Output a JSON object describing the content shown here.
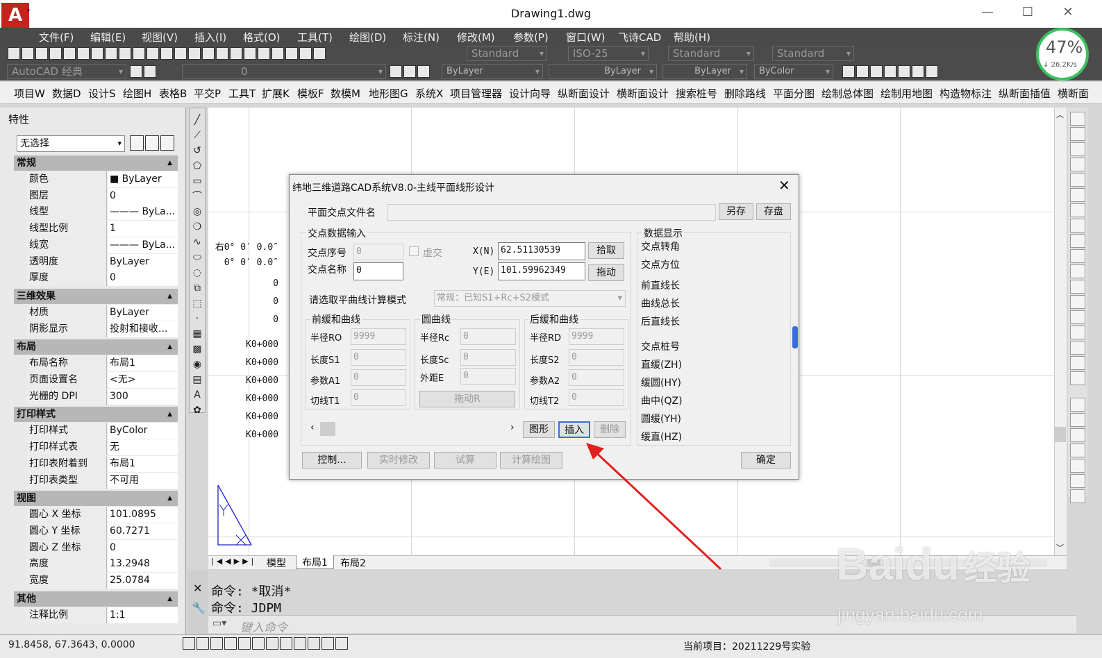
{
  "window": {
    "title": "Drawing1.dwg",
    "minimize": "—",
    "maximize": "☐",
    "close": "✕",
    "logo": "A"
  },
  "menu": [
    "文件(F)",
    "编辑(E)",
    "视图(V)",
    "插入(I)",
    "格式(O)",
    "工具(T)",
    "绘图(D)",
    "标注(N)",
    "修改(M)",
    "参数(P)",
    "窗口(W)",
    "飞诗CAD",
    "帮助(H)"
  ],
  "styles": {
    "text_style": "Standard",
    "dim_style": "ISO-25",
    "table_style": "Standard",
    "mleader_style": "Standard"
  },
  "workspace": "AutoCAD 经典",
  "layer": {
    "current": "0",
    "color": "ByLayer",
    "linetype": "ByLayer",
    "lineweight": "ByLayer",
    "plotstyle": "ByColor"
  },
  "network": {
    "percent": "47%",
    "speed": "26.2K/s"
  },
  "custom_menu": [
    "项目W",
    "数据D",
    "设计S",
    "绘图H",
    "表格B",
    "平交P",
    "工具T",
    "扩展K",
    "模板F",
    "数模M",
    "地形图G",
    "系统X",
    "项目管理器",
    "设计向导",
    "纵断面设计",
    "横断面设计",
    "搜索桩号",
    "删除路线",
    "平面分图",
    "绘制总体图",
    "绘制用地图",
    "构造物标注",
    "纵断面插值",
    "横断面"
  ],
  "properties": {
    "title": "特性",
    "selection": "无选择",
    "sections": [
      {
        "title": "常规",
        "rows": [
          [
            "颜色",
            "■ ByLayer"
          ],
          [
            "图层",
            "0"
          ],
          [
            "线型",
            "——— ByLa..."
          ],
          [
            "线型比例",
            "1"
          ],
          [
            "线宽",
            "——— ByLa..."
          ],
          [
            "透明度",
            "ByLayer"
          ],
          [
            "厚度",
            "0"
          ]
        ]
      },
      {
        "title": "三维效果",
        "rows": [
          [
            "材质",
            "ByLayer"
          ],
          [
            "阴影显示",
            "投射和接收..."
          ]
        ]
      },
      {
        "title": "布局",
        "rows": [
          [
            "布局名称",
            "布局1"
          ],
          [
            "页面设置名",
            "<无>"
          ],
          [
            "光栅的 DPI",
            "300"
          ]
        ]
      },
      {
        "title": "打印样式",
        "rows": [
          [
            "打印样式",
            "ByColor"
          ],
          [
            "打印样式表",
            "无"
          ],
          [
            "打印表附着到",
            "布局1"
          ],
          [
            "打印表类型",
            "不可用"
          ]
        ]
      },
      {
        "title": "视图",
        "rows": [
          [
            "圆心 X 坐标",
            "101.0895"
          ],
          [
            "圆心 Y 坐标",
            "60.7271"
          ],
          [
            "圆心 Z 坐标",
            "0"
          ],
          [
            "高度",
            "13.2948"
          ],
          [
            "宽度",
            "25.0784"
          ]
        ]
      },
      {
        "title": "其他",
        "rows": [
          [
            "注释比例",
            "1:1"
          ]
        ]
      }
    ]
  },
  "dialog": {
    "title": "纬地三维道路CAD系统V8.0-主线平面线形设计",
    "file_label": "平面交点文件名",
    "file_value": "",
    "save_as": "另存",
    "save": "存盘",
    "input_group": "交点数据输入",
    "ip_no_label": "交点序号",
    "ip_no": "0",
    "virtual_label": "虚交",
    "ip_name_label": "交点名称",
    "ip_name": "0",
    "x_label": "X(N)",
    "x_value": "62.51130539",
    "y_label": "Y(E)",
    "y_value": "101.59962349",
    "pick": "拾取",
    "drag": "拖动",
    "mode_label": "请选取平曲线计算模式",
    "mode_value": "常规：已知S1+Rc+S2模式",
    "front_group": "前缓和曲线",
    "r0_label": "半径RO",
    "r0": "9999",
    "s1_label": "长度S1",
    "s1": "0",
    "a1_label": "参数A1",
    "a1": "0",
    "t1_label": "切线T1",
    "t1": "0",
    "circle_group": "圆曲线",
    "rc_label": "半径Rc",
    "rc": "0",
    "sc_label": "长度Sc",
    "sc": "0",
    "e_label": "外距E",
    "e": "0",
    "drag_r": "拖动R",
    "back_group": "后缓和曲线",
    "rd_label": "半径RD",
    "rd": "9999",
    "s2_label": "长度S2",
    "s2": "0",
    "a2_label": "参数A2",
    "a2": "0",
    "t2_label": "切线T2",
    "t2": "0",
    "graph": "图形",
    "insert": "插入",
    "delete": "删除",
    "control": "控制...",
    "realtime": "实时修改",
    "trial": "试算",
    "calc_draw": "计算绘图",
    "ok": "确定",
    "display_group": "数据显示",
    "display": [
      [
        "交点转角",
        "右0° 0′ 0.0″"
      ],
      [
        "交点方位",
        "0° 0′ 0.0″"
      ],
      [
        "前直线长",
        "0"
      ],
      [
        "曲线总长",
        "0"
      ],
      [
        "后直线长",
        "0"
      ],
      [
        "交点桩号",
        "K0+000"
      ],
      [
        "直缓(ZH)",
        "K0+000"
      ],
      [
        "缓圆(HY)",
        "K0+000"
      ],
      [
        "曲中(QZ)",
        "K0+000"
      ],
      [
        "圆缓(YH)",
        "K0+000"
      ],
      [
        "缓直(HZ)",
        "K0+000"
      ]
    ]
  },
  "tabs": [
    "模型",
    "布局1",
    "布局2"
  ],
  "command": {
    "line1": "命令: *取消*",
    "line2": "命令: JDPM",
    "prompt": "键入命令"
  },
  "status": {
    "coords": "91.8458, 67.3643, 0.0000",
    "project": "当前项目：20211229号实验"
  },
  "watermark": {
    "brand": "Baidu",
    "product": "经验",
    "url": "jingyan.baidu.com"
  },
  "colors": {
    "accent_arrow": "#e02020",
    "dialog_bg": "#f0f0f0",
    "dark_toolbar": "#4b4b4b",
    "logo_red": "#c4241c"
  }
}
